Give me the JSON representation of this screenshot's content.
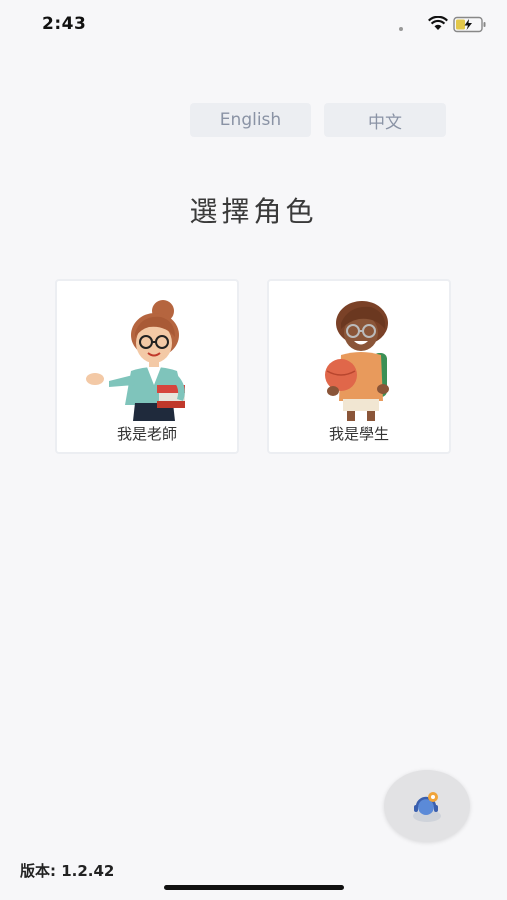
{
  "status_bar": {
    "time": "2:43"
  },
  "language": {
    "english_label": "English",
    "chinese_label": "中文"
  },
  "title": "選擇角色",
  "roles": [
    {
      "label": "我是老師",
      "icon": "teacher-illustration"
    },
    {
      "label": "我是學生",
      "icon": "student-illustration"
    }
  ],
  "footer": {
    "version": "版本: 1.2.42"
  },
  "colors": {
    "background": "#f7f7f9",
    "button_bg": "#eceef2",
    "button_text": "#8a93a5"
  }
}
